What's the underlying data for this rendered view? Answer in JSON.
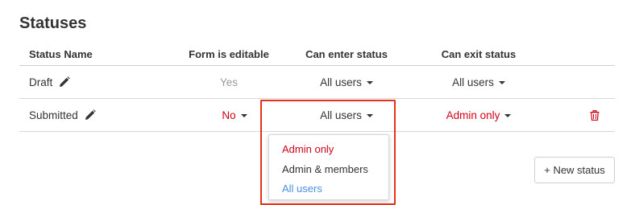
{
  "title": "Statuses",
  "columns": {
    "name": "Status Name",
    "editable": "Form is editable",
    "enter": "Can enter status",
    "exit": "Can exit status"
  },
  "rows": [
    {
      "name": "Draft",
      "editable": "Yes",
      "enter": "All users",
      "exit": "All users"
    },
    {
      "name": "Submitted",
      "editable": "No",
      "enter": "All users",
      "exit": "Admin only"
    }
  ],
  "dropdown": {
    "options": [
      "Admin only",
      "Admin & members",
      "All users"
    ],
    "selected": "All users"
  },
  "new_status_label": "+ New status",
  "icons": {
    "edit": "pencil-icon",
    "delete": "trash-icon",
    "caret": "caret-down-icon"
  },
  "colors": {
    "admin_red": "#d0021b",
    "selected_blue": "#4a90e2",
    "highlight_border": "#e8311a",
    "muted_gray": "#9a9a9a"
  }
}
